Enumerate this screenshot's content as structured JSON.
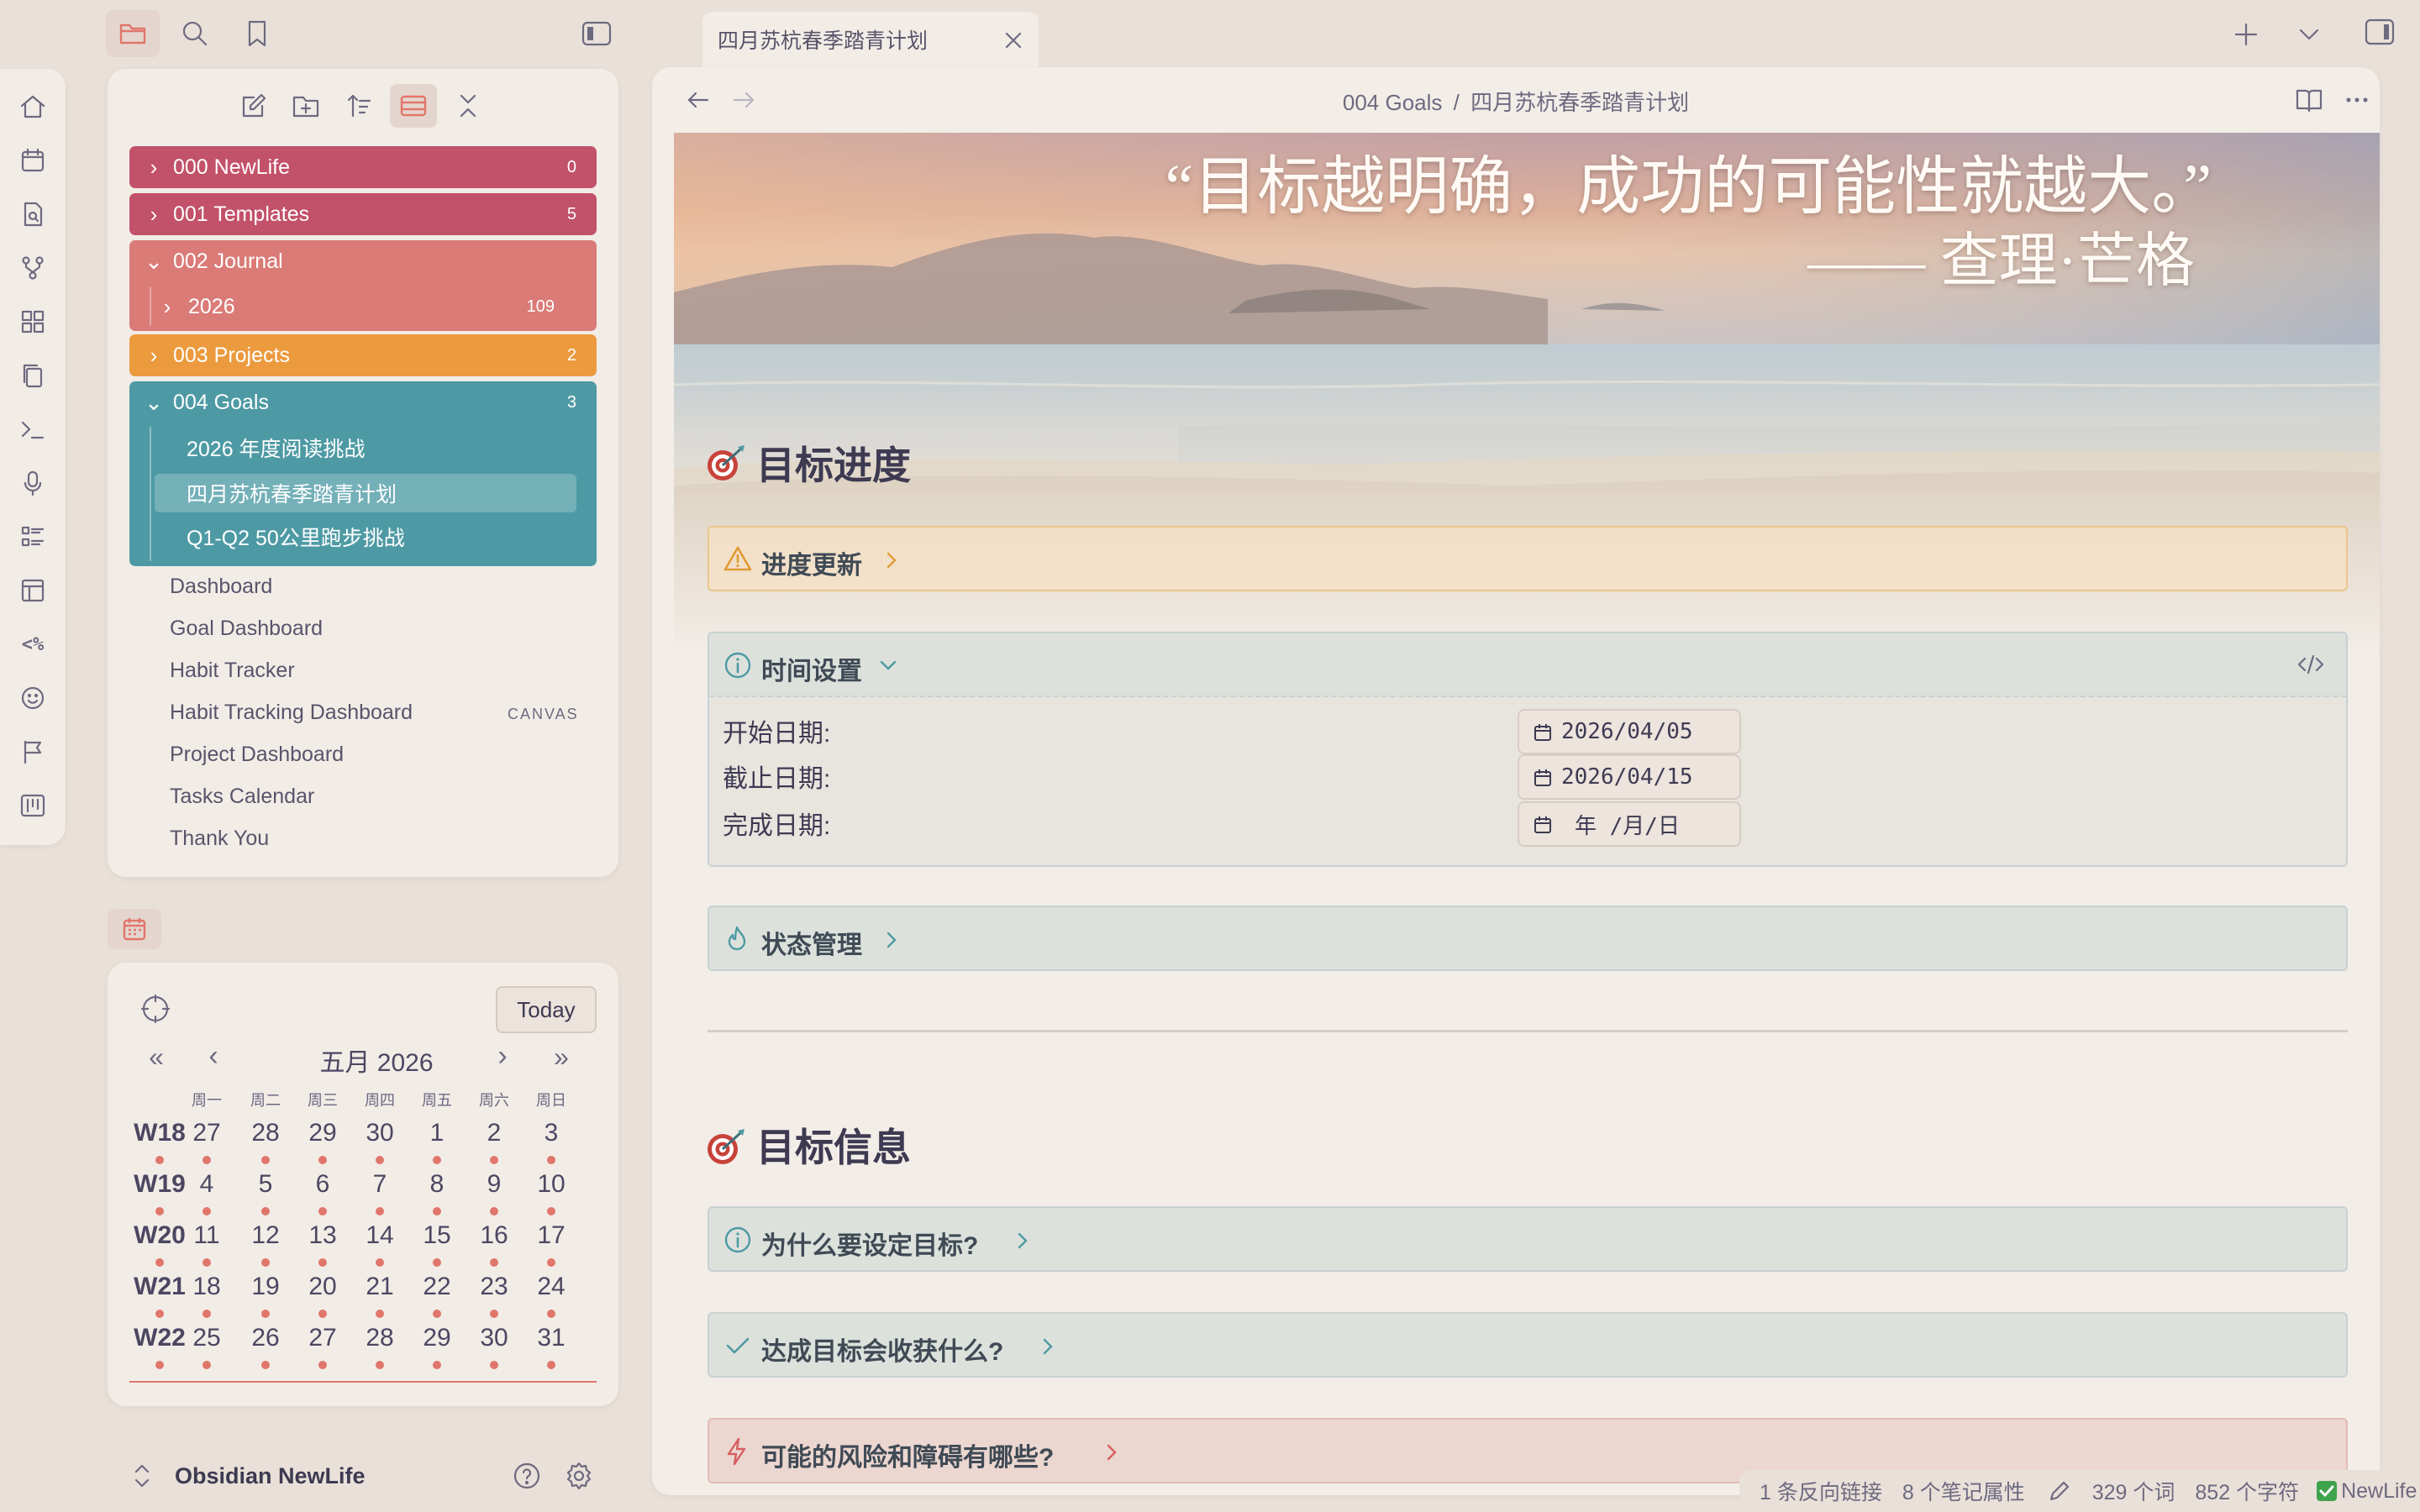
{
  "tab": {
    "title": "四月苏杭春季踏青计划"
  },
  "breadcrumb": {
    "folder": "004 Goals",
    "sep": "/",
    "note": "四月苏杭春季踏青计划"
  },
  "explorer": {
    "folders": [
      {
        "name": "000 NewLife",
        "count": "0",
        "color": "#c2516a",
        "expanded": false
      },
      {
        "name": "001 Templates",
        "count": "5",
        "color": "#c2516a",
        "expanded": false
      },
      {
        "name": "002 Journal",
        "count": "",
        "color": "#da7b77",
        "expanded": true
      },
      {
        "name": "003 Projects",
        "count": "2",
        "color": "#eb9a3e",
        "expanded": false
      },
      {
        "name": "004 Goals",
        "count": "3",
        "color": "#4e9aa4",
        "expanded": true
      }
    ],
    "journal_sub": {
      "name": "2026",
      "count": "109"
    },
    "goals_notes": [
      "2026 年度阅读挑战",
      "四月苏杭春季踏青计划",
      "Q1-Q2 50公里跑步挑战"
    ],
    "files": [
      "Dashboard",
      "Goal Dashboard",
      "Habit Tracker",
      "Habit Tracking Dashboard",
      "Project Dashboard",
      "Tasks Calendar",
      "Thank You"
    ],
    "canvas_tag": "CANVAS"
  },
  "calendar": {
    "today_label": "Today",
    "month_label": "五月  2026",
    "weekdays": [
      "周一",
      "周二",
      "周三",
      "周四",
      "周五",
      "周六",
      "周日"
    ],
    "weeks": [
      {
        "label": "W18",
        "days": [
          "27",
          "28",
          "29",
          "30",
          "1",
          "2",
          "3"
        ]
      },
      {
        "label": "W19",
        "days": [
          "4",
          "5",
          "6",
          "7",
          "8",
          "9",
          "10"
        ]
      },
      {
        "label": "W20",
        "days": [
          "11",
          "12",
          "13",
          "14",
          "15",
          "16",
          "17"
        ]
      },
      {
        "label": "W21",
        "days": [
          "18",
          "19",
          "20",
          "21",
          "22",
          "23",
          "24"
        ]
      },
      {
        "label": "W22",
        "days": [
          "25",
          "26",
          "27",
          "28",
          "29",
          "30",
          "31"
        ]
      }
    ]
  },
  "vault": {
    "name": "Obsidian NewLife"
  },
  "note": {
    "quote": "“目标越明确，成功的可能性就越大。”",
    "author": "—— 查理·芒格",
    "section1": "目标进度",
    "callout_progress": "进度更新",
    "callout_time": "时间设置",
    "start_label": "开始日期:",
    "start_value": "2026/04/05",
    "end_label": "截止日期:",
    "end_value": "2026/04/15",
    "done_label": "完成日期:",
    "done_value": "年 /月/日",
    "callout_status": "状态管理",
    "section2": "目标信息",
    "callout_why": "为什么要设定目标?",
    "callout_gain": "达成目标会收获什么?",
    "callout_risk": "可能的风险和障碍有哪些?"
  },
  "statusbar": {
    "backlinks": "1 条反向链接",
    "props": "8 个笔记属性",
    "words": "329 个词",
    "chars": "852 个字符",
    "vault": "NewLife"
  }
}
